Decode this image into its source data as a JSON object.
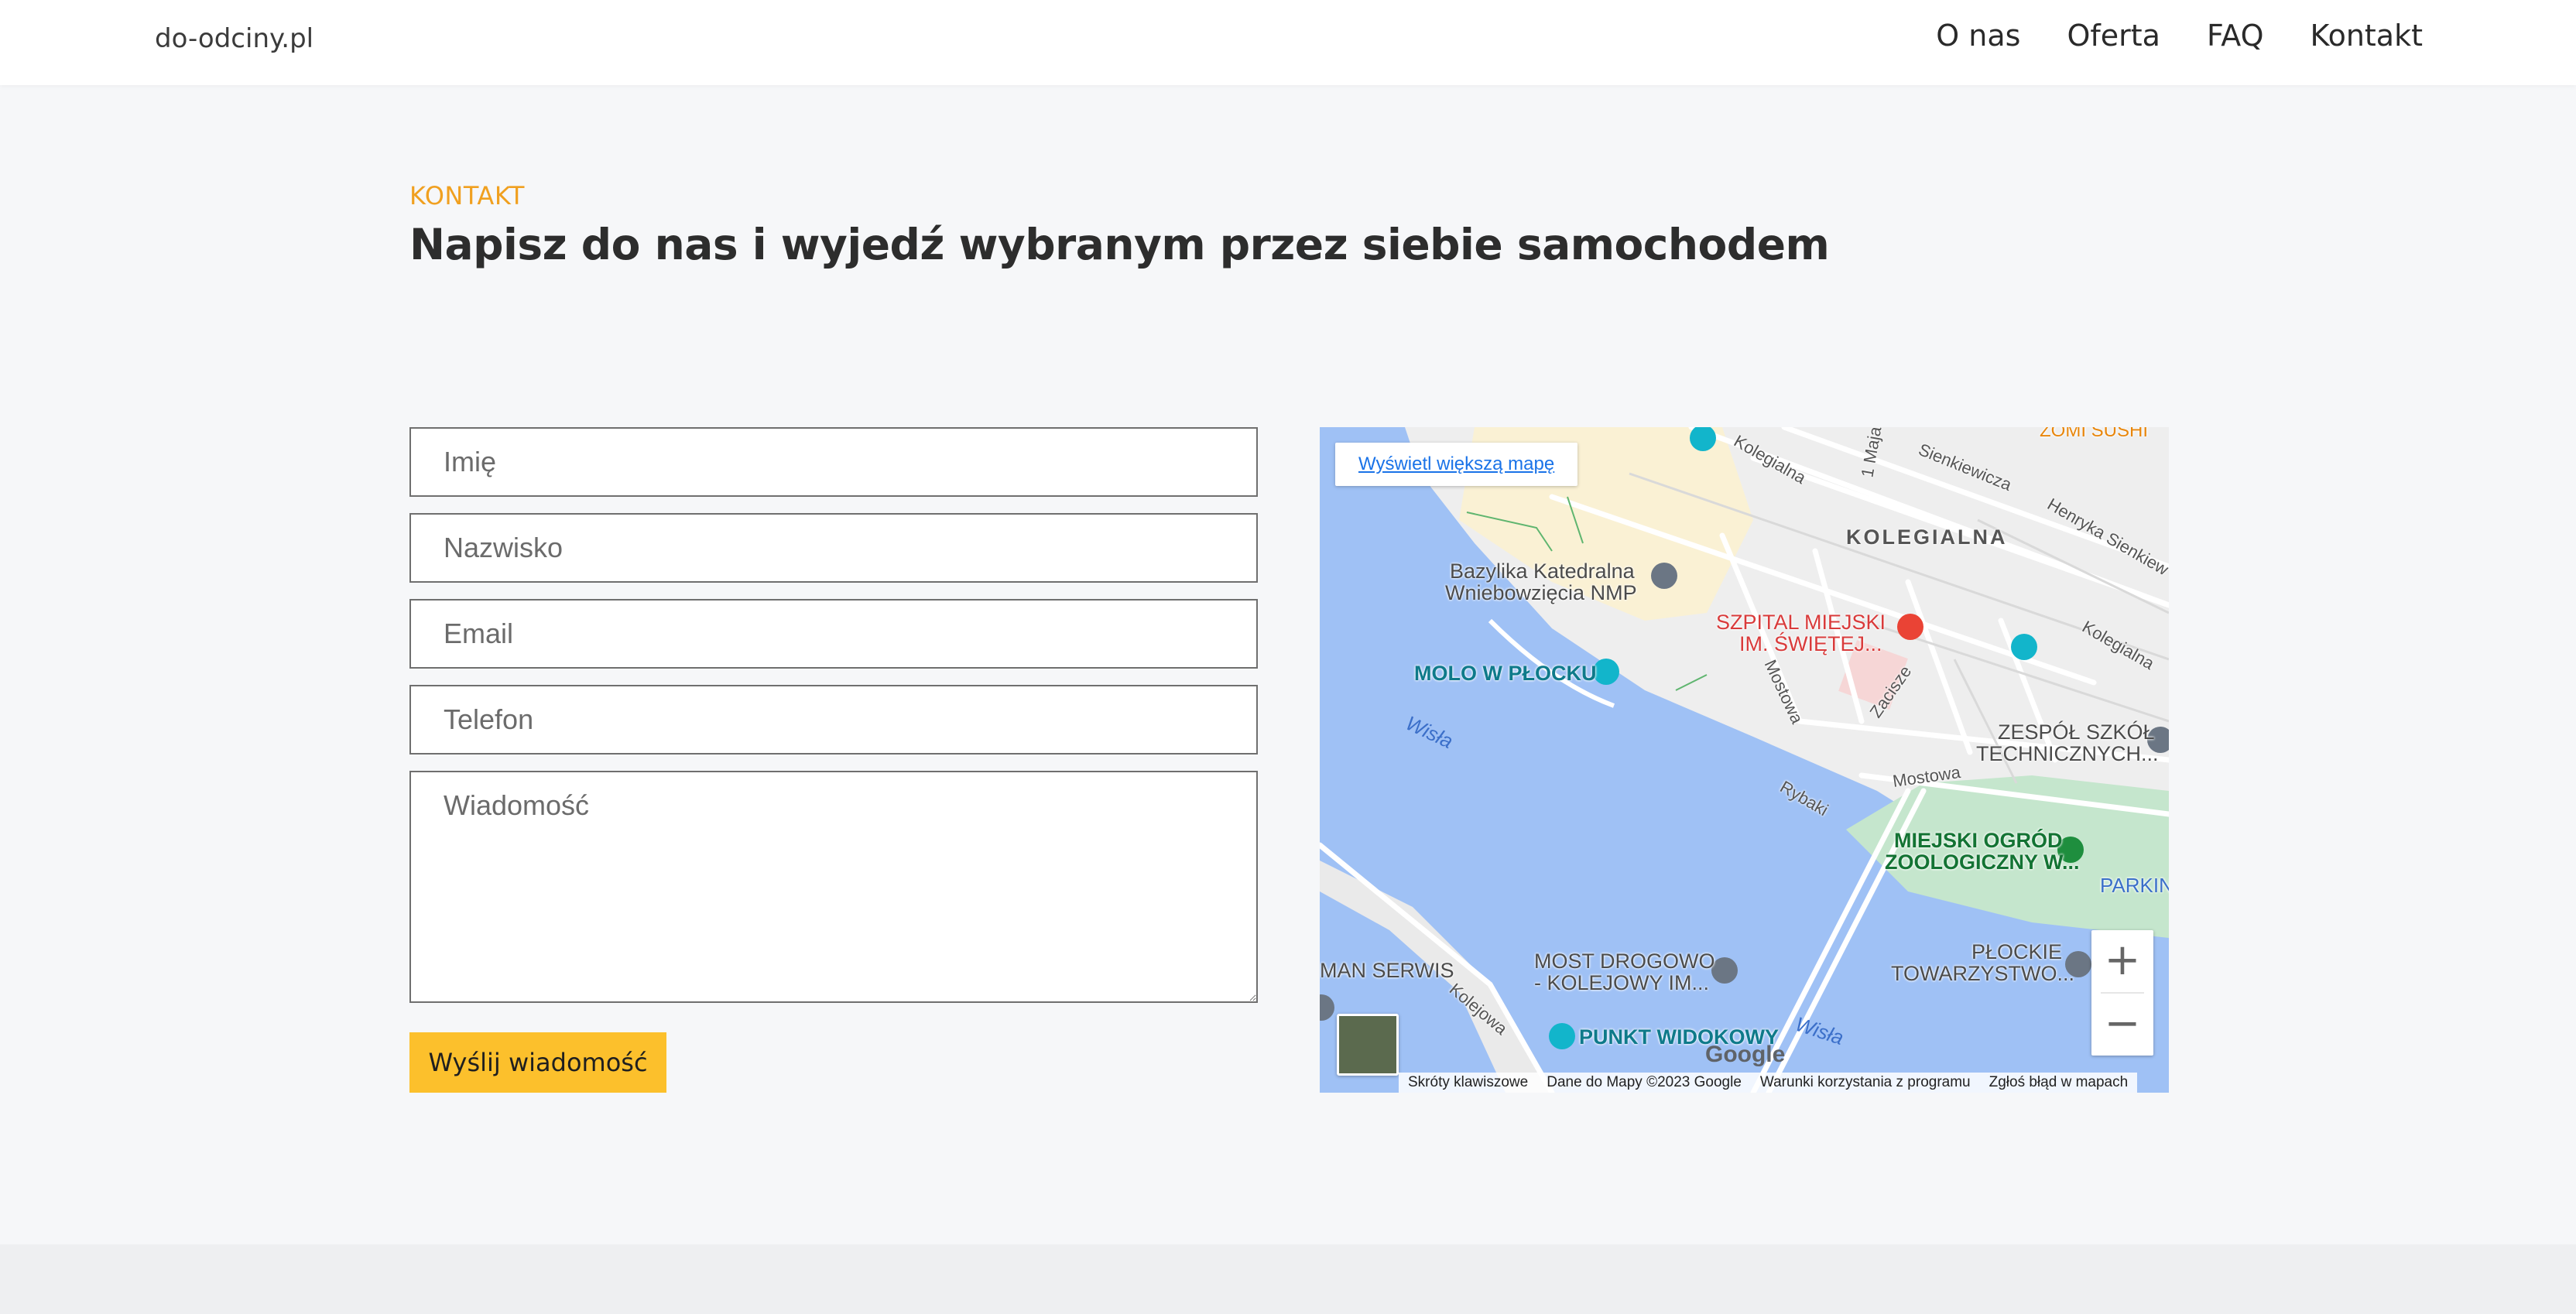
{
  "header": {
    "brand": "do-odciny.pl",
    "nav": [
      "O nas",
      "Oferta",
      "FAQ",
      "Kontakt"
    ]
  },
  "section": {
    "eyebrow": "KONTAKT",
    "title": "Napisz do nas i wyjedź wybranym przez siebie samochodem"
  },
  "form": {
    "first_name_placeholder": "Imię",
    "last_name_placeholder": "Nazwisko",
    "email_placeholder": "Email",
    "phone_placeholder": "Telefon",
    "message_placeholder": "Wiadomość",
    "submit_label": "Wyślij wiadomość"
  },
  "map": {
    "view_larger": "Wyświetl większą mapę",
    "labels": {
      "kolegialna_district": "KOLEGIALNA",
      "basilica_1": "Bazylika Katedralna",
      "basilica_2": "Wniebowzięcia NMP",
      "hospital_1": "SZPITAL MIEJSKI",
      "hospital_2": "IM. ŚWIĘTEJ...",
      "molo": "MOLO W PŁOCKU",
      "wisla_1": "Wisła",
      "wisla_2": "Wisła",
      "school_1": "ZESPÓŁ SZKÓŁ",
      "school_2": "TECHNICZNYCH...",
      "zoo_1": "MIEJSKI OGRÓD",
      "zoo_2": "ZOOLOGICZNY W...",
      "parking": "PARKIN",
      "bridge_1": "MOST DROGOWO",
      "bridge_2": "- KOLEJOWY IM...",
      "towarzystwo_1": "PŁOCKIE",
      "towarzystwo_2": "TOWARZYSTWO...",
      "serwis": "MAN SERWIS",
      "viewpoint": "PUNKT WIDOKOWY",
      "sushi": "ZOMI SUSHI",
      "street_kolegialna_1": "Kolegialna",
      "street_kolegialna_2": "Kolegialna",
      "street_sienkiewicza": "Sienkiewicza",
      "street_henryka": "Henryka Sienkiew",
      "street_1maja": "1 Maja",
      "street_mostowa_1": "Mostowa",
      "street_mostowa_2": "Mostowa",
      "street_zacisze": "Zacisze",
      "street_rybaki": "Rybaki",
      "street_kolejowa": "Kolejowa"
    },
    "footer": [
      "Skróty klawiszowe",
      "Dane do Mapy ©2023 Google",
      "Warunki korzystania z programu",
      "Zgłoś błąd w mapach"
    ],
    "google": "Google",
    "zoom_in": "+",
    "zoom_out": "−",
    "colors": {
      "water": "#9fc1f5",
      "land": "#eeeeee",
      "park": "#c5e6cd",
      "urban": "#faf1d4"
    }
  },
  "colors": {
    "accent": "#f0a020",
    "button": "#fcc02c",
    "background": "#f6f7f9"
  }
}
